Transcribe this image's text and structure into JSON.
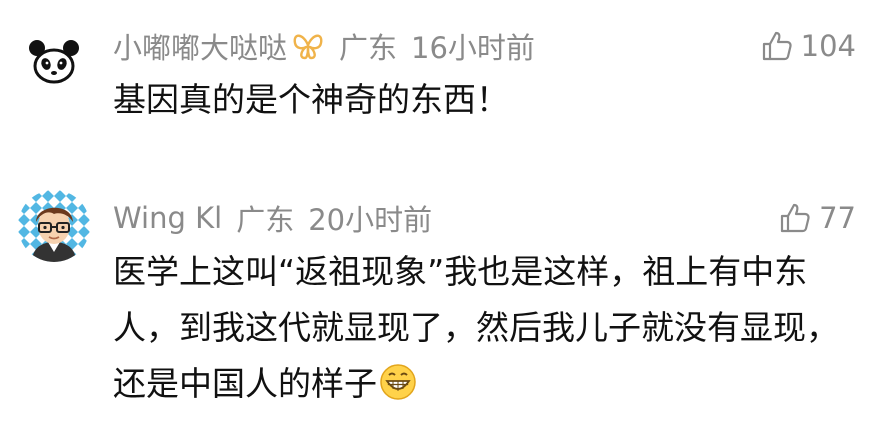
{
  "comments": [
    {
      "username": "小嘟嘟大哒哒",
      "location": "广东",
      "time": "16小时前",
      "likes": "104",
      "avatar": "panda-avatar",
      "badge": "butterfly-icon",
      "text": "基因真的是个神奇的东西！"
    },
    {
      "username": "Wing Kl",
      "location": "广东",
      "time": "20小时前",
      "likes": "77",
      "avatar": "glasses-boy-avatar",
      "text": "医学上这叫“返祖现象”我也是这样，祖上有中东人，到我这代就显现了，然后我儿子就没有显现，还是中国人的样子",
      "trailing_emoji": "grinning-face-emoji"
    }
  ],
  "colors": {
    "meta_text": "#8a8a8a",
    "body_text": "#111111",
    "badge_gold": "#f0b34a",
    "avatar_pattern": "#52b7e3"
  }
}
